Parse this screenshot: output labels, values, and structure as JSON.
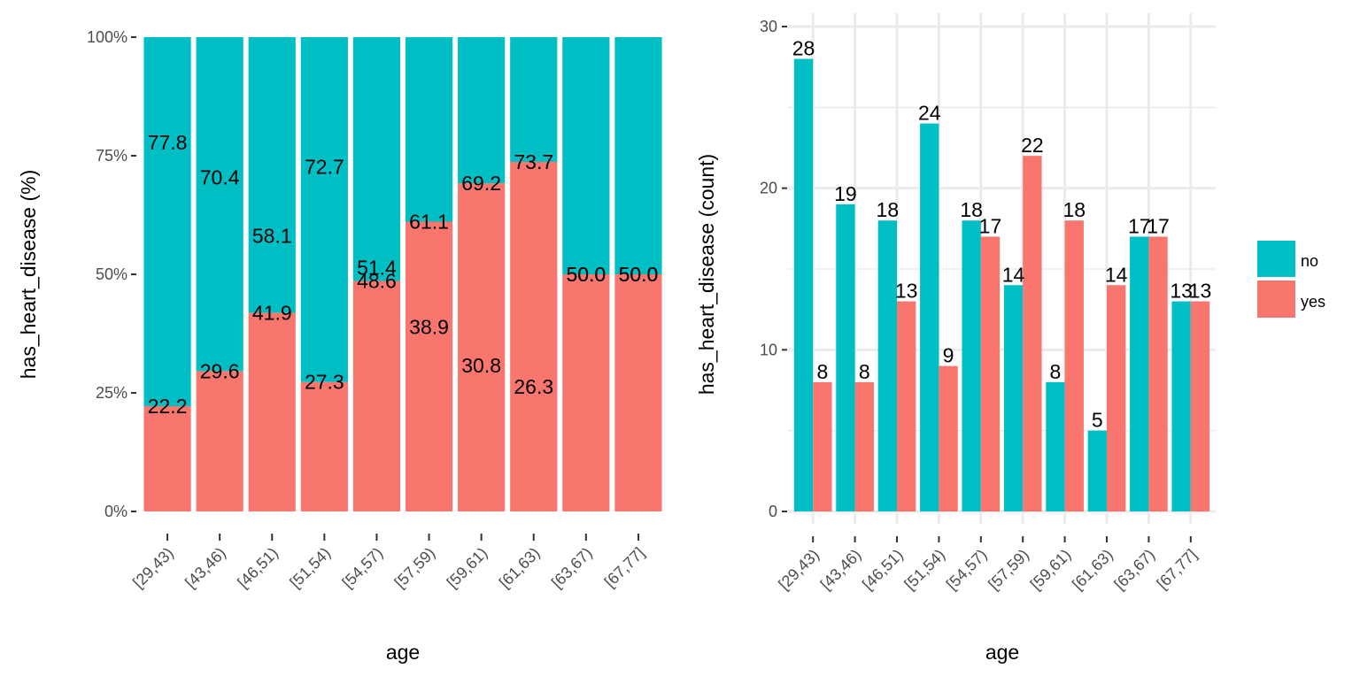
{
  "colors": {
    "no": "#00BFC4",
    "yes": "#F8766D",
    "grid": "#ebebeb",
    "tick": "#333333"
  },
  "chart_data": [
    {
      "type": "bar",
      "stacked": true,
      "position": "fill",
      "title": "",
      "xlabel": "age",
      "ylabel": "has_heart_disease  (%)",
      "ylim": [
        0,
        100
      ],
      "yticks": [
        0,
        25,
        50,
        75,
        100
      ],
      "ytick_labels": [
        "0%",
        "25%",
        "50%",
        "75%",
        "100%"
      ],
      "grid": false,
      "categories": [
        "[29,43)",
        "[43,46)",
        "[46,51)",
        "[51,54)",
        "[54,57)",
        "[57,59)",
        "[59,61)",
        "[61,63)",
        "[63,67)",
        "[67,77]"
      ],
      "series": [
        {
          "name": "yes",
          "values": [
            22.2,
            29.6,
            41.9,
            27.3,
            48.6,
            61.1,
            69.2,
            73.7,
            50.0,
            50.0
          ],
          "labels": [
            "22.2",
            "29.6",
            "41.9",
            "27.3",
            "48.6",
            "61.1",
            "69.2",
            "73.7",
            "50.0",
            "50.0"
          ]
        },
        {
          "name": "no",
          "values": [
            77.8,
            70.4,
            58.1,
            72.7,
            51.4,
            38.9,
            30.8,
            26.3,
            50.0,
            50.0
          ],
          "labels": [
            "77.8",
            "70.4",
            "58.1",
            "72.7",
            "51.4",
            "38.9",
            "30.8",
            "26.3",
            "50.0",
            "50.0"
          ]
        }
      ]
    },
    {
      "type": "bar",
      "stacked": false,
      "position": "dodge",
      "title": "",
      "xlabel": "age",
      "ylabel": "has_heart_disease  (count)",
      "ylim": [
        0,
        30
      ],
      "yticks": [
        0,
        10,
        20,
        30
      ],
      "ytick_labels": [
        "0",
        "10",
        "20",
        "30"
      ],
      "grid": true,
      "categories": [
        "[29,43)",
        "[43,46)",
        "[46,51)",
        "[51,54)",
        "[54,57)",
        "[57,59)",
        "[59,61)",
        "[61,63)",
        "[63,67)",
        "[67,77]"
      ],
      "series": [
        {
          "name": "no",
          "values": [
            28,
            19,
            18,
            24,
            18,
            14,
            8,
            5,
            17,
            13
          ]
        },
        {
          "name": "yes",
          "values": [
            8,
            8,
            13,
            9,
            17,
            22,
            18,
            14,
            17,
            13
          ]
        }
      ],
      "legend": {
        "position": "right",
        "title": "",
        "entries": [
          "no",
          "yes"
        ]
      }
    }
  ]
}
